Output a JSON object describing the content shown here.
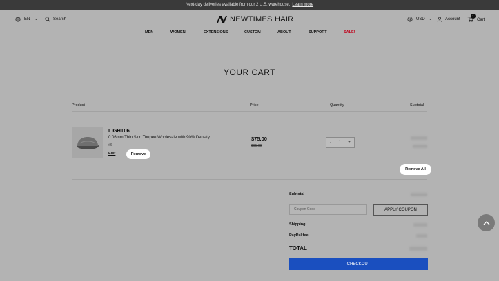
{
  "announcement": {
    "text": "Next-day deliveries available from our 2 U.S. warehouse.",
    "link": "Learn more"
  },
  "header": {
    "language": "EN",
    "search": "Search",
    "brand": "NEWTIMES HAIR",
    "currency": "USD",
    "account": "Account",
    "cart": "Cart",
    "cart_count": "1"
  },
  "nav": {
    "men": "MEN",
    "women": "WOMEN",
    "extensions": "EXTENSIONS",
    "custom": "CUSTOM",
    "about": "ABOUT",
    "support": "SUPPORT",
    "sale": "SALE!"
  },
  "page_title": "YOUR CART",
  "table": {
    "product": "Product",
    "price": "Price",
    "quantity": "Quantity",
    "subtotal": "Subtotal"
  },
  "item": {
    "name": "LIGHT06",
    "description": "0.06mm Thin Skin Toupee Wholesale with 90% Density",
    "variant": "#6",
    "edit": "Edit",
    "remove": "Remove",
    "price": "$75.00",
    "old_price": "$95.00",
    "qty": "1",
    "minus": "-",
    "plus": "+"
  },
  "remove_all": "Remove All",
  "summary": {
    "subtotal": "Subtotal",
    "coupon_placeholder": "Coupon Code",
    "apply": "APPLY COUPON",
    "shipping": "Shipping",
    "paypal": "PayPal fee",
    "total": "TOTAL",
    "checkout": "CHECKOUT"
  },
  "colors": {
    "checkout": "#1a4fbf",
    "sale": "#c0001a",
    "overlay": "#b3b3b3"
  }
}
